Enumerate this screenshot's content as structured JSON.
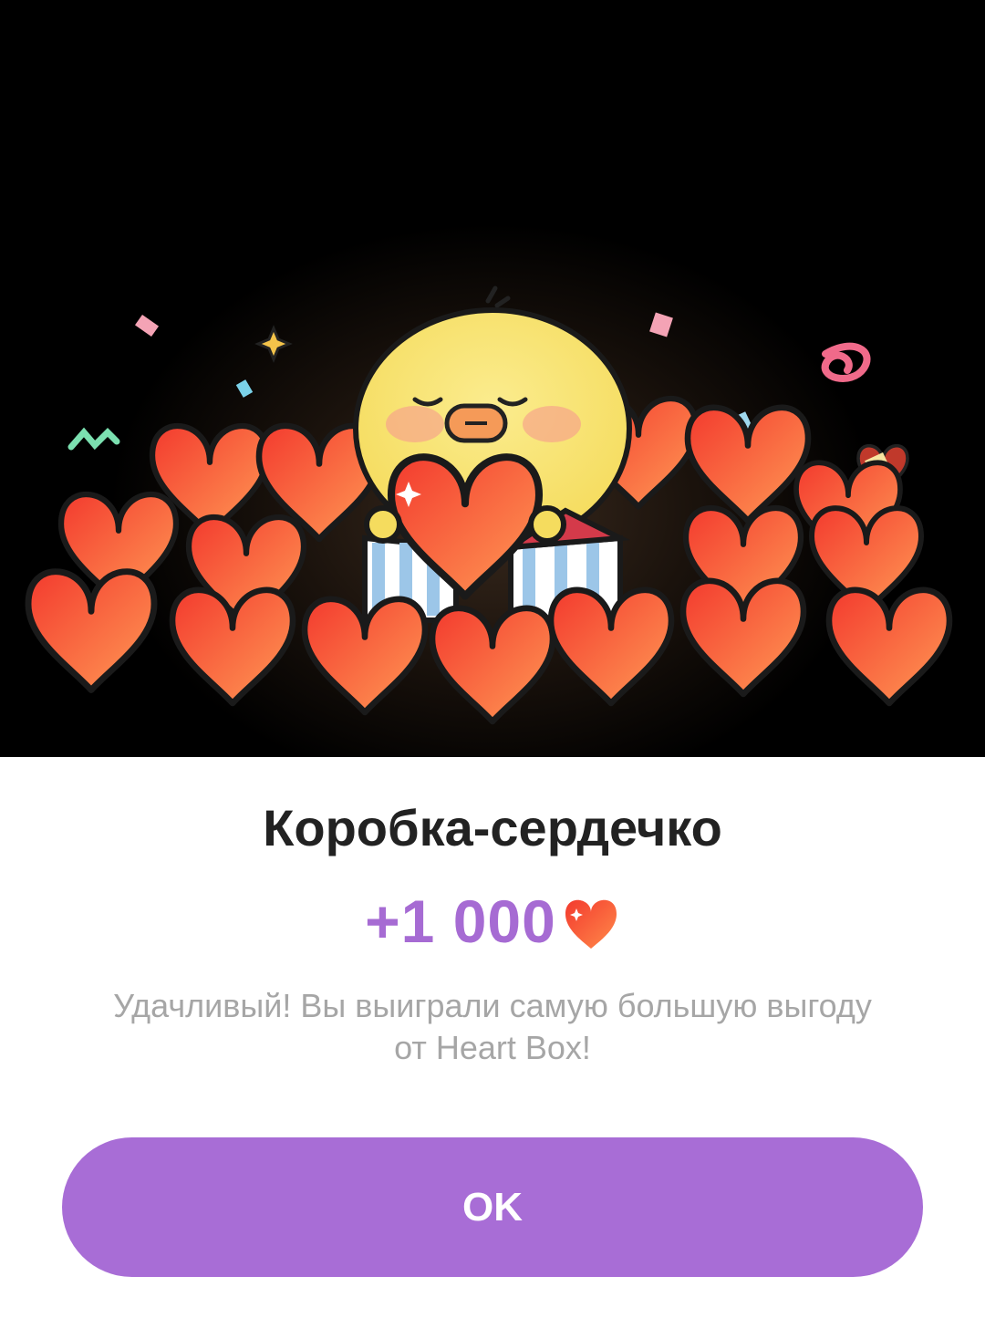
{
  "dialog": {
    "title": "Коробка-сердечко",
    "reward_amount": "+1 000",
    "reward_icon": "heart-icon",
    "description_line1": "Удачливый! Вы выиграли самую большую выгоду",
    "description_line2": "от Heart Box!",
    "ok_label": "OK"
  },
  "colors": {
    "accent": "#a86dd6",
    "reward_text": "#a66bd3",
    "heart": "#f4553a",
    "background_top": "#000000"
  }
}
